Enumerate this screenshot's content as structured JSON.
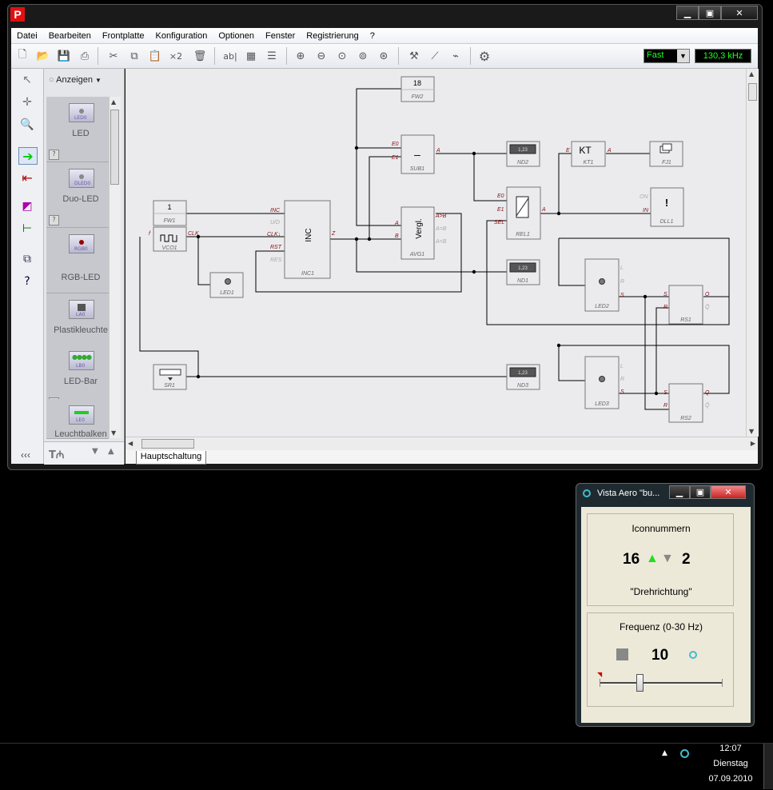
{
  "menu": [
    "Datei",
    "Bearbeiten",
    "Frontplatte",
    "Konfiguration",
    "Optionen",
    "Fenster",
    "Registrierung",
    "?"
  ],
  "toolbar": {
    "speed_value": "Fast",
    "frequency_display": "130,3 kHz",
    "x2_label": "×2",
    "ab_label": "ab|"
  },
  "palette": {
    "filter_label": "Anzeigen",
    "items": [
      {
        "label": "LED",
        "icon_tag": "LED0"
      },
      {
        "label": "Duo-LED",
        "icon_tag": "DLED0"
      },
      {
        "label": "RGB-LED",
        "icon_tag": "RGB0"
      },
      {
        "label": "Plastikleuchte",
        "icon_tag": "LA0"
      },
      {
        "label": "LED-Bar",
        "icon_tag": "LB0"
      },
      {
        "label": "Leuchtbalken",
        "icon_tag": "LE0"
      }
    ],
    "collapse_label": "‹‹‹"
  },
  "tab": {
    "label": "Hauptschaltung"
  },
  "circuit": {
    "fw2": {
      "value": "18",
      "name": "FW2"
    },
    "fw1": {
      "value": "1",
      "name": "FW1"
    },
    "vco1": {
      "name": "VCO1",
      "pin_in": "f",
      "pin_out": "CLK"
    },
    "inc1": {
      "title": "INC",
      "name": "INC1",
      "pins": [
        "INC",
        "U/D",
        "CLK↓",
        "RST",
        "RES"
      ],
      "out": "Z"
    },
    "sub1": {
      "symbol": "–",
      "name": "SUB1",
      "in1": "E0",
      "in2": "E1",
      "out": "A"
    },
    "avg1": {
      "title": "Vergl.",
      "name": "AVG1",
      "in1": "A",
      "in2": "B",
      "out1": "A>B",
      "out2": "A=B",
      "out3": "A<B"
    },
    "nd2": {
      "value": "1,23",
      "name": "ND2"
    },
    "nd1": {
      "value": "1,23",
      "name": "ND1"
    },
    "nd3": {
      "value": "1,23",
      "name": "ND3"
    },
    "kt1": {
      "title": "KT",
      "name": "KT1",
      "in": "E",
      "out": "A"
    },
    "fj1": {
      "name": "FJ1"
    },
    "dll1": {
      "name": "DLL1",
      "pin_on": "ON",
      "pin_in": "IN",
      "symbol": "!"
    },
    "rel1": {
      "name": "REL1",
      "in1": "E0",
      "in2": "E1",
      "in3": "SEL",
      "out": "A"
    },
    "led1": {
      "name": "LED1"
    },
    "led2": {
      "name": "LED2",
      "pins": [
        "L",
        "R",
        "S"
      ]
    },
    "led3": {
      "name": "LED3",
      "pins": [
        "L",
        "R",
        "S"
      ]
    },
    "rs1": {
      "name": "RS1",
      "in1": "S",
      "in2": "R",
      "out1": "Q",
      "out2": "Q̄"
    },
    "rs2": {
      "name": "RS2",
      "in1": "S",
      "in2": "R",
      "out1": "Q",
      "out2": "Q̄"
    },
    "sr1": {
      "name": "SR1"
    }
  },
  "vista": {
    "title": "Vista Aero \"bu...",
    "icon_heading": "Iconnummern",
    "icon_left": "16",
    "icon_right": "2",
    "direction_label": "\"Drehrichtung\"",
    "freq_heading": "Frequenz (0-30 Hz)",
    "freq_value": "10",
    "slider_fraction": 0.33
  },
  "clock": {
    "time": "12:07",
    "day": "Dienstag",
    "date": "07.09.2010"
  },
  "colors": {
    "accent_green": "#22dd22",
    "pin_red": "#8a1010"
  }
}
